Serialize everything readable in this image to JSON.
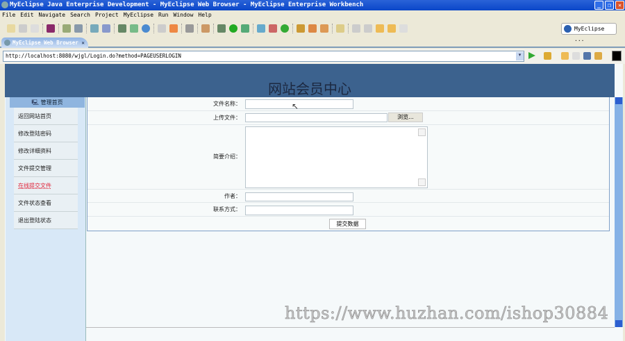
{
  "window": {
    "title": "MyEclipse Java Enterprise Development - MyEclipse Web Browser - MyEclipse Enterprise Workbench"
  },
  "menu": [
    "File",
    "Edit",
    "Navigate",
    "Search",
    "Project",
    "MyEclipse",
    "Run",
    "Window",
    "Help"
  ],
  "perspective": "MyEclipse ...",
  "tab": {
    "label": "MyEclipse Web Browser",
    "close": "✕"
  },
  "browser": {
    "url": "http://localhost:8080/wjgl/Login.do?method=PAGEUSERLOGIN"
  },
  "page": {
    "title": "网站会员中心",
    "sidebar": {
      "header": "管理首页",
      "items": [
        "返回网站首页",
        "修改登陆密码",
        "修改详细资料",
        "文件提交管理",
        "在线提交文件",
        "文件状态查看",
        "退出登陆状态"
      ]
    },
    "form": {
      "file_name_label": "文件名称：",
      "upload_label": "上传文件：",
      "browse_label": "浏览...",
      "intro_label": "简要介绍：",
      "author_label": "作者：",
      "contact_label": "联系方式：",
      "submit_label": "提交数据"
    }
  },
  "watermark": "https://www.huzhan.com/ishop30884"
}
